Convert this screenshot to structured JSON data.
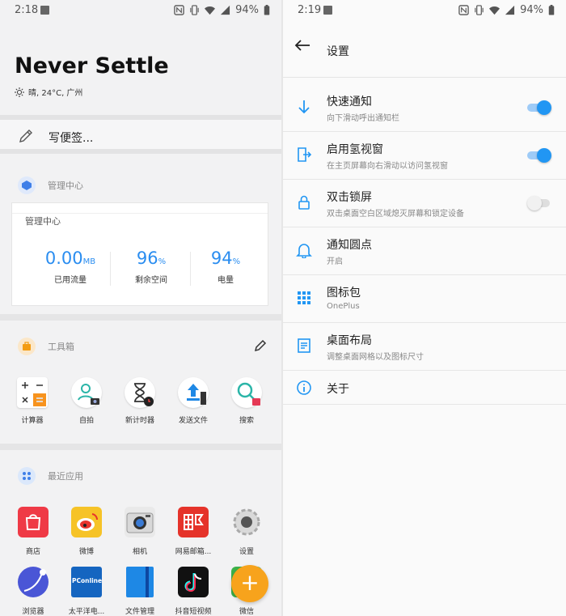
{
  "left": {
    "status": {
      "time": "2:18",
      "battery": "94%"
    },
    "hero_title": "Never Settle",
    "weather": "晴, 24°C, 广州",
    "note_label": "写便签...",
    "management": {
      "section_title": "管理中心",
      "card_title": "管理中心",
      "stats": [
        {
          "value": "0.00",
          "unit": "MB",
          "label": "已用流量"
        },
        {
          "value": "96",
          "unit": "%",
          "label": "剩余空间"
        },
        {
          "value": "94",
          "unit": "%",
          "label": "电量"
        }
      ]
    },
    "toolbox": {
      "section_title": "工具箱",
      "items": [
        {
          "label": "计算器",
          "icon": "calculator-icon"
        },
        {
          "label": "自拍",
          "icon": "selfie-icon"
        },
        {
          "label": "新计时器",
          "icon": "timer-icon"
        },
        {
          "label": "发送文件",
          "icon": "send-file-icon"
        },
        {
          "label": "搜索",
          "icon": "search-icon"
        }
      ]
    },
    "recent": {
      "section_title": "最近应用",
      "apps": [
        {
          "label": "商店",
          "icon": "store-icon"
        },
        {
          "label": "微博",
          "icon": "weibo-icon"
        },
        {
          "label": "相机",
          "icon": "camera-icon"
        },
        {
          "label": "网易邮箱...",
          "icon": "mail-icon"
        },
        {
          "label": "设置",
          "icon": "settings-gear-icon"
        },
        {
          "label": "浏览器",
          "icon": "browser-icon"
        },
        {
          "label": "太平洋电...",
          "icon": "pconline-icon"
        },
        {
          "label": "文件管理",
          "icon": "file-manager-icon"
        },
        {
          "label": "抖音短视频",
          "icon": "douyin-icon"
        },
        {
          "label": "微信",
          "icon": "wechat-icon"
        }
      ]
    },
    "fab_label": "+",
    "pconline_text": "PConline"
  },
  "right": {
    "status": {
      "time": "2:19",
      "battery": "94%"
    },
    "title": "设置",
    "rows": [
      {
        "title": "快速通知",
        "subtitle": "向下滑动呼出通知栏",
        "icon": "arrow-down-icon",
        "toggle": "on"
      },
      {
        "title": "启用氢视窗",
        "subtitle": "在主页屏幕向右滑动以访问氢视窗",
        "icon": "shelf-enter-icon",
        "toggle": "on"
      },
      {
        "title": "双击锁屏",
        "subtitle": "双击桌面空白区域熄灭屏幕和锁定设备",
        "icon": "lock-icon",
        "toggle": "off"
      },
      {
        "title": "通知圆点",
        "subtitle": "开启",
        "icon": "bell-icon"
      },
      {
        "title": "图标包",
        "subtitle": "OnePlus",
        "icon": "grid-icon"
      },
      {
        "title": "桌面布局",
        "subtitle": "调整桌面网格以及图标尺寸",
        "icon": "layout-icon"
      },
      {
        "title": "关于",
        "subtitle": "",
        "icon": "info-icon"
      }
    ]
  },
  "colors": {
    "accent": "#2196f3",
    "fab": "#f7a31c"
  }
}
